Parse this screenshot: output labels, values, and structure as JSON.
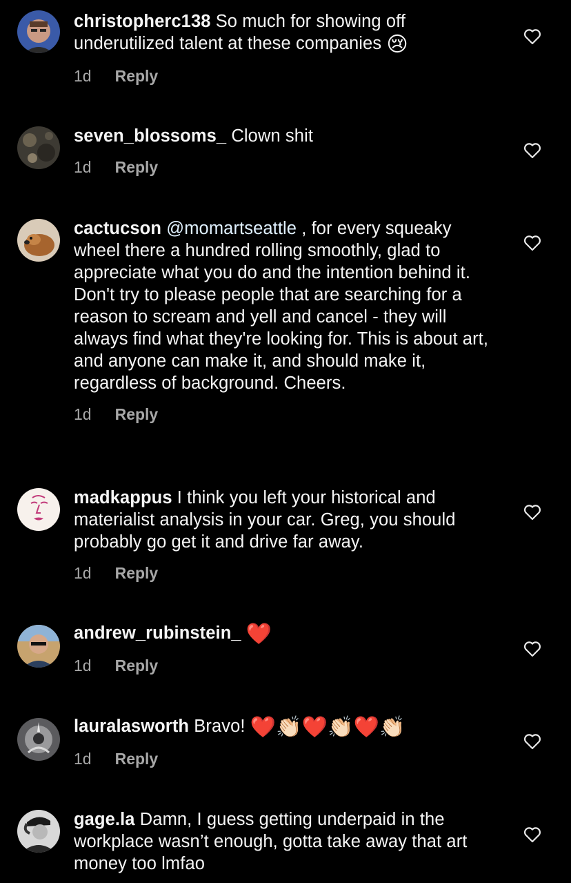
{
  "colors": {
    "background": "#000000",
    "text": "#f5f5f5",
    "meta": "#a8a8a8",
    "heart_emoji": "#e0242a"
  },
  "comments": [
    {
      "username": "christopherc138",
      "text": "So much for showing off underutilized talent at these companies",
      "emoji": "😢",
      "time": "1d",
      "reply_label": "Reply"
    },
    {
      "username": "seven_blossoms_",
      "text": "Clown shit",
      "time": "1d",
      "reply_label": "Reply"
    },
    {
      "username": "cactucson",
      "mention": "@momartseattle",
      "text": ", for every squeaky wheel there a hundred rolling smoothly, glad to appreciate what you do and the intention behind it. Don't try to please people that are searching for a reason to scream and yell and cancel - they will always find what they're looking for. This is about art, and anyone can make it, and should make it, regardless of background. Cheers.",
      "time": "1d",
      "reply_label": "Reply"
    },
    {
      "username": "madkappus",
      "text": "I think you left your historical and materialist analysis in your car. Greg, you should probably go get it and drive far away.",
      "time": "1d",
      "reply_label": "Reply"
    },
    {
      "username": "andrew_rubinstein_",
      "emoji": "❤️",
      "time": "1d",
      "reply_label": "Reply"
    },
    {
      "username": "lauralasworth",
      "text": "Bravo!",
      "emojis": [
        "❤️",
        "👏🏻",
        "❤️",
        "👏🏻",
        "❤️",
        "👏🏻"
      ],
      "time": "1d",
      "reply_label": "Reply"
    },
    {
      "username": "gage.la",
      "text": "Damn, I guess getting underpaid in the workplace wasn’t enough, gotta take away that art money too lmfao"
    }
  ],
  "icons": {
    "like": "heart-outline-icon"
  }
}
